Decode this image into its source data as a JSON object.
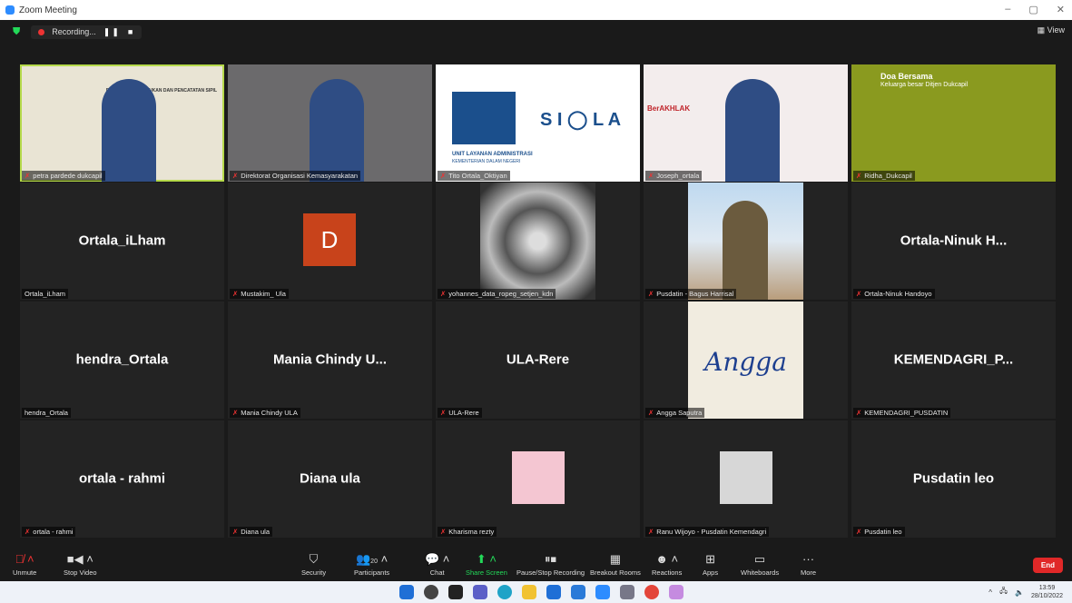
{
  "window": {
    "title": "Zoom Meeting",
    "minimize": "–",
    "maximize": "▢",
    "close": "✕"
  },
  "topbar": {
    "recording_label": "Recording...",
    "pause": "❚❚",
    "stop": "■",
    "view_label": "View"
  },
  "tiles": [
    {
      "label": "petra pardede dukcapil",
      "big": "",
      "kind": "video",
      "bg": "#e9e4d4",
      "active": true
    },
    {
      "label": "Direktorat Organisasi Kemasyarakatan",
      "big": "",
      "kind": "video",
      "bg": "#6b6a6c"
    },
    {
      "label": "Tito Ortala_Oktiyan",
      "big": "",
      "kind": "siola",
      "bg": "#ffffff"
    },
    {
      "label": "Joseph_ortala",
      "big": "",
      "kind": "video",
      "bg": "#f3eded"
    },
    {
      "label": "Ridha_Dukcapil",
      "big": "",
      "kind": "doa",
      "bg": "#8a9a1f"
    },
    {
      "label": "Ortala_iLham",
      "big": "Ortala_iLham",
      "kind": "name",
      "nomic": true
    },
    {
      "label": "Mustakim_ Ula",
      "big": "",
      "kind": "avatar",
      "avatar": "D"
    },
    {
      "label": "yohannes_data_ropeg_setjen_kdn",
      "big": "",
      "kind": "kaleido"
    },
    {
      "label": "Pusdatin - Bagus Harrisal",
      "big": "",
      "kind": "photo"
    },
    {
      "label": "Ortala-Ninuk Handoyo",
      "big": "Ortala-Ninuk H...",
      "kind": "name"
    },
    {
      "label": "hendra_Ortala",
      "big": "hendra_Ortala",
      "kind": "name",
      "nomic": true
    },
    {
      "label": "Mania Chindy ULA",
      "big": "Mania Chindy U...",
      "kind": "name"
    },
    {
      "label": "ULA-Rere",
      "big": "ULA-Rere",
      "kind": "name"
    },
    {
      "label": "Angga Saputra",
      "big": "Angga",
      "kind": "angga"
    },
    {
      "label": "KEMENDAGRI_PUSDATIN",
      "big": "KEMENDAGRI_P...",
      "kind": "name"
    },
    {
      "label": "ortala - rahmi",
      "big": "ortala - rahmi",
      "kind": "name"
    },
    {
      "label": "Diana ula",
      "big": "Diana ula",
      "kind": "name"
    },
    {
      "label": "Kharisma rezty",
      "big": "",
      "kind": "smallpic",
      "pic": "#f4c6d2"
    },
    {
      "label": "Ranu Wijoyo - Pusdatin Kemendagri",
      "big": "",
      "kind": "smallpic",
      "pic": "#d7d7d7"
    },
    {
      "label": "Pusdatin leo",
      "big": "Pusdatin leo",
      "kind": "name"
    }
  ],
  "siola": {
    "text": "S I ◯ L A",
    "ula": "UNIT LAYANAN ADMINISTRASI",
    "kdn": "KEMENTERIAN DALAM NEGERI"
  },
  "doa": {
    "title": "Doa Bersama",
    "subtitle": "Keluarga besar Ditjen Dukcapil"
  },
  "banner1": "DITJEN KEPENDUDUKAN DAN PENCATATAN SIPIL",
  "berakhlak": "BerAKHLAK",
  "controls": {
    "unmute": "Unmute",
    "stop_video": "Stop Video",
    "security": "Security",
    "participants": "Participants",
    "participants_count": "20",
    "chat": "Chat",
    "share": "Share Screen",
    "pause_rec": "Pause/Stop Recording",
    "breakout": "Breakout Rooms",
    "reactions": "Reactions",
    "apps": "Apps",
    "whiteboards": "Whiteboards",
    "more": "More",
    "end": "End"
  },
  "taskbar": {
    "time": "13:59",
    "date": "28/10/2022"
  }
}
